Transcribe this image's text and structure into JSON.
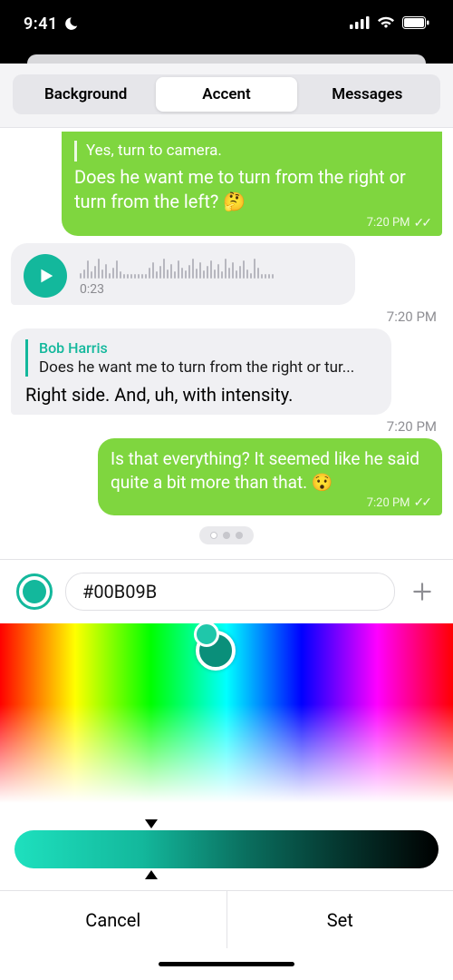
{
  "status": {
    "time": "9:41"
  },
  "tabs": {
    "background": "Background",
    "accent": "Accent",
    "messages": "Messages"
  },
  "chat": {
    "m1_quote": "Yes, turn to camera.",
    "m1_text": "Does he want me to turn from the right or turn from the left? 🤔",
    "m1_time": "7:20 PM",
    "voice_duration": "0:23",
    "voice_time": "7:20 PM",
    "reply_name": "Bob Harris",
    "reply_snip": "Does he want me to turn from the right or tur...",
    "reply_body": "Right side. And, uh, with intensity.",
    "reply_time": "7:20 PM",
    "m2_text": "Is that everything? It seemed like he said quite a bit more than that. 😯",
    "m2_time": "7:20 PM"
  },
  "picker": {
    "hex": "#00B09B",
    "accent_color": "#13b89c"
  },
  "buttons": {
    "cancel": "Cancel",
    "set": "Set"
  }
}
